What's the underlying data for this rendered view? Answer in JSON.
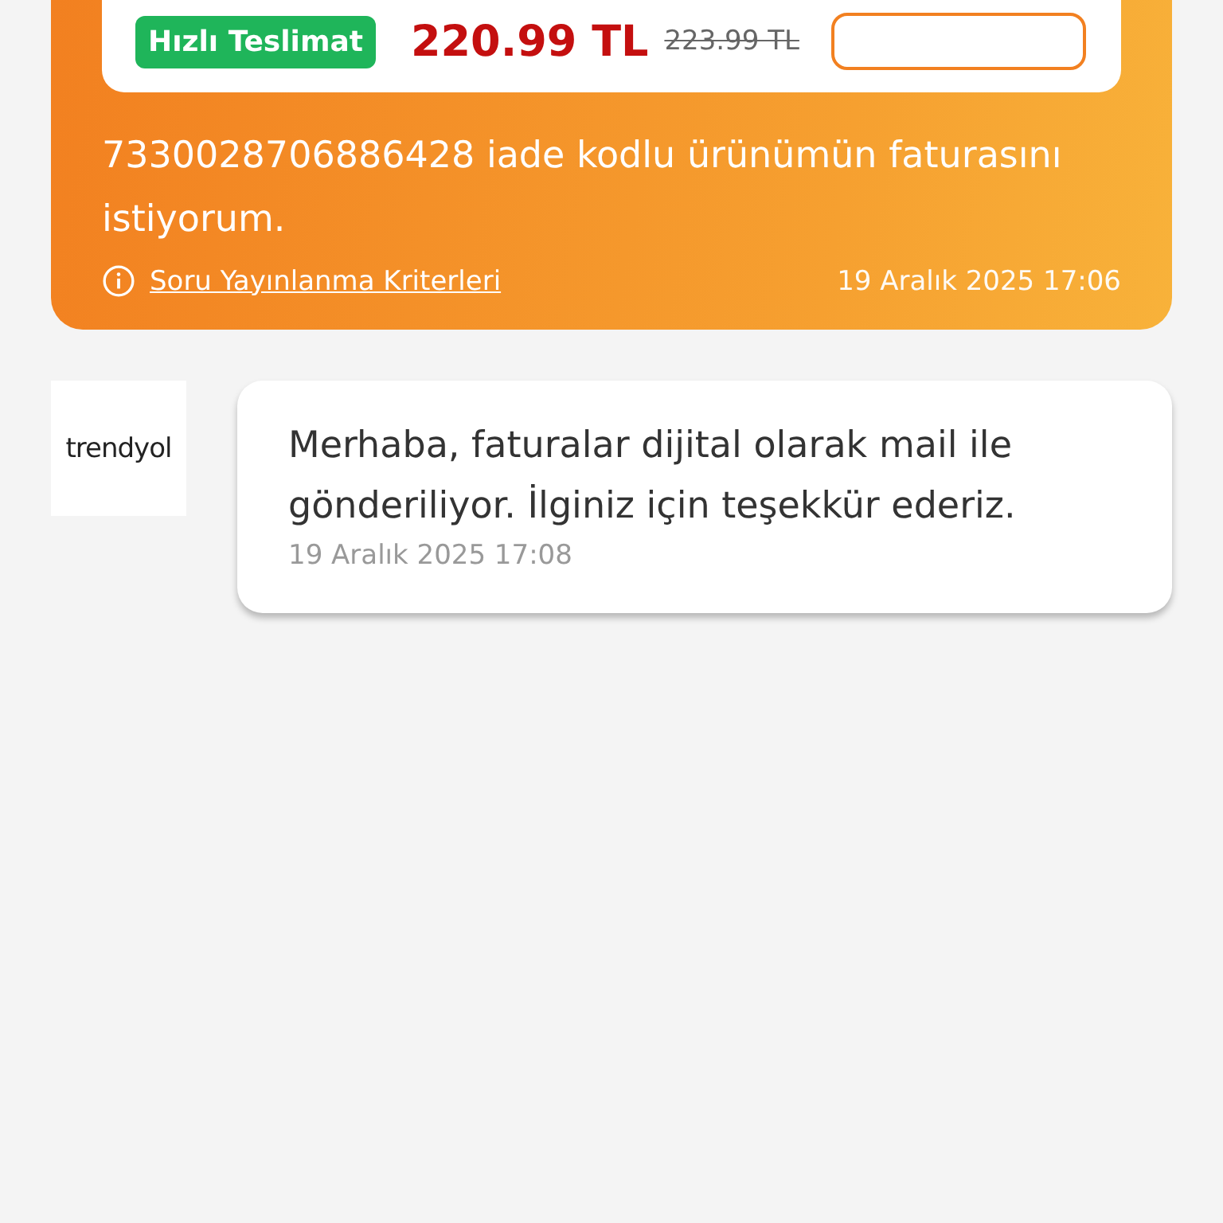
{
  "question": {
    "product": {
      "badge": "Hızlı Teslimat",
      "price": "220.99 TL",
      "old_price": "223.99 TL"
    },
    "text": "7330028706886428 iade kodlu ürünümün faturasını istiyorum.",
    "criteria_link": "Soru Yayınlanma Kriterleri",
    "date": "19 Aralık 2025 17:06"
  },
  "answer": {
    "seller": "trendyol",
    "text": "Merhaba, faturalar dijital olarak mail ile gönderiliyor. İlginiz için teşekkür ederiz.",
    "date": "19 Aralık 2025 17:08"
  }
}
